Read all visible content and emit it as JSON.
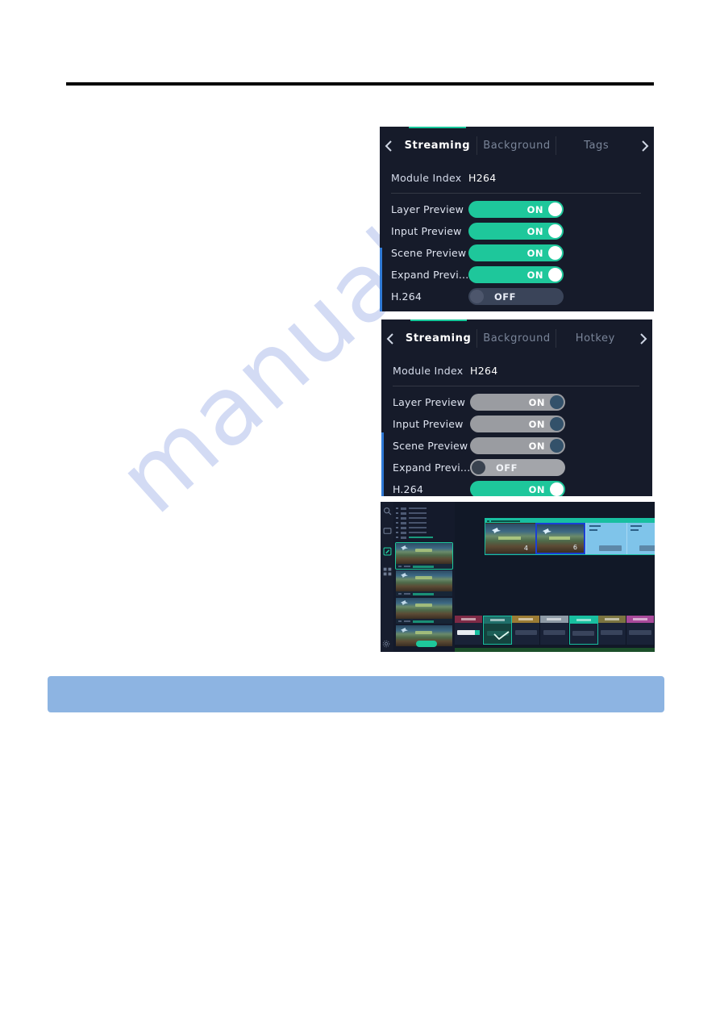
{
  "page": {
    "rule_color": "#000000",
    "callout_bar_color": "#8db4e2",
    "watermark_text": "manualshi"
  },
  "theme": {
    "panel_bg": "#161b2a",
    "accent_green": "#1ec79b",
    "accent_blue": "#2f7ad6",
    "tab_active_underline": "#16c79a",
    "toggle_off_bg": "#3a4459",
    "toggle_disabled_bg": "#9a9ca1"
  },
  "panel_streaming_tags": {
    "nav": {
      "prev_icon": "chevron-left-icon",
      "next_icon": "chevron-right-icon"
    },
    "tabs": [
      {
        "label": "Streaming",
        "active": true
      },
      {
        "label": "Background",
        "active": false
      },
      {
        "label": "Tags",
        "active": false
      }
    ],
    "module_index": {
      "label": "Module Index",
      "value": "H264"
    },
    "settings": [
      {
        "label": "Layer Preview",
        "state": "ON",
        "style": "on"
      },
      {
        "label": "Input Preview",
        "state": "ON",
        "style": "on"
      },
      {
        "label": "Scene Preview",
        "state": "ON",
        "style": "on"
      },
      {
        "label": "Expand Previ...",
        "state": "ON",
        "style": "on"
      },
      {
        "label": "H.264",
        "state": "OFF",
        "style": "off"
      }
    ]
  },
  "panel_streaming_hotkey": {
    "nav": {
      "prev_icon": "chevron-left-icon",
      "next_icon": "chevron-right-icon"
    },
    "tabs": [
      {
        "label": "Streaming",
        "active": true
      },
      {
        "label": "Background",
        "active": false
      },
      {
        "label": "Hotkey",
        "active": false
      }
    ],
    "module_index": {
      "label": "Module Index",
      "value": "H264"
    },
    "settings": [
      {
        "label": "Layer Preview",
        "state": "ON",
        "style": "on-dim"
      },
      {
        "label": "Input Preview",
        "state": "ON",
        "style": "on-dim"
      },
      {
        "label": "Scene Preview",
        "state": "ON",
        "style": "on-dim"
      },
      {
        "label": "Expand Previ...",
        "state": "OFF",
        "style": "off-dim"
      },
      {
        "label": "H.264",
        "state": "ON",
        "style": "on"
      }
    ]
  },
  "panel_console": {
    "sidebar_icons": [
      {
        "name": "search-icon",
        "active": false
      },
      {
        "name": "monitor-icon",
        "active": false
      },
      {
        "name": "edit-icon",
        "active": true
      },
      {
        "name": "grid-icon",
        "active": false
      }
    ],
    "footer_icon": "gear-icon",
    "thumbnails": [
      {
        "selected": true
      },
      {
        "selected": false
      },
      {
        "selected": false
      },
      {
        "selected": false
      }
    ],
    "preview_window": {
      "cells": [
        {
          "type": "thumbnail",
          "number": "4",
          "selected": false
        },
        {
          "type": "thumbnail",
          "number": "6",
          "selected": true
        },
        {
          "type": "blank",
          "has_button": true
        },
        {
          "type": "blank",
          "has_button": true
        }
      ]
    },
    "scenes": [
      {
        "color": "#7e2a46",
        "kind": "progress"
      },
      {
        "color": "#1f6f6a",
        "kind": "selected"
      },
      {
        "color": "#9b7b34",
        "kind": "plain"
      },
      {
        "color": "#8e9aa6",
        "kind": "plain"
      },
      {
        "color": "#18bfa0",
        "kind": "plain"
      },
      {
        "color": "#7b7440",
        "kind": "plain"
      },
      {
        "color": "#a8499a",
        "kind": "plain"
      }
    ]
  }
}
